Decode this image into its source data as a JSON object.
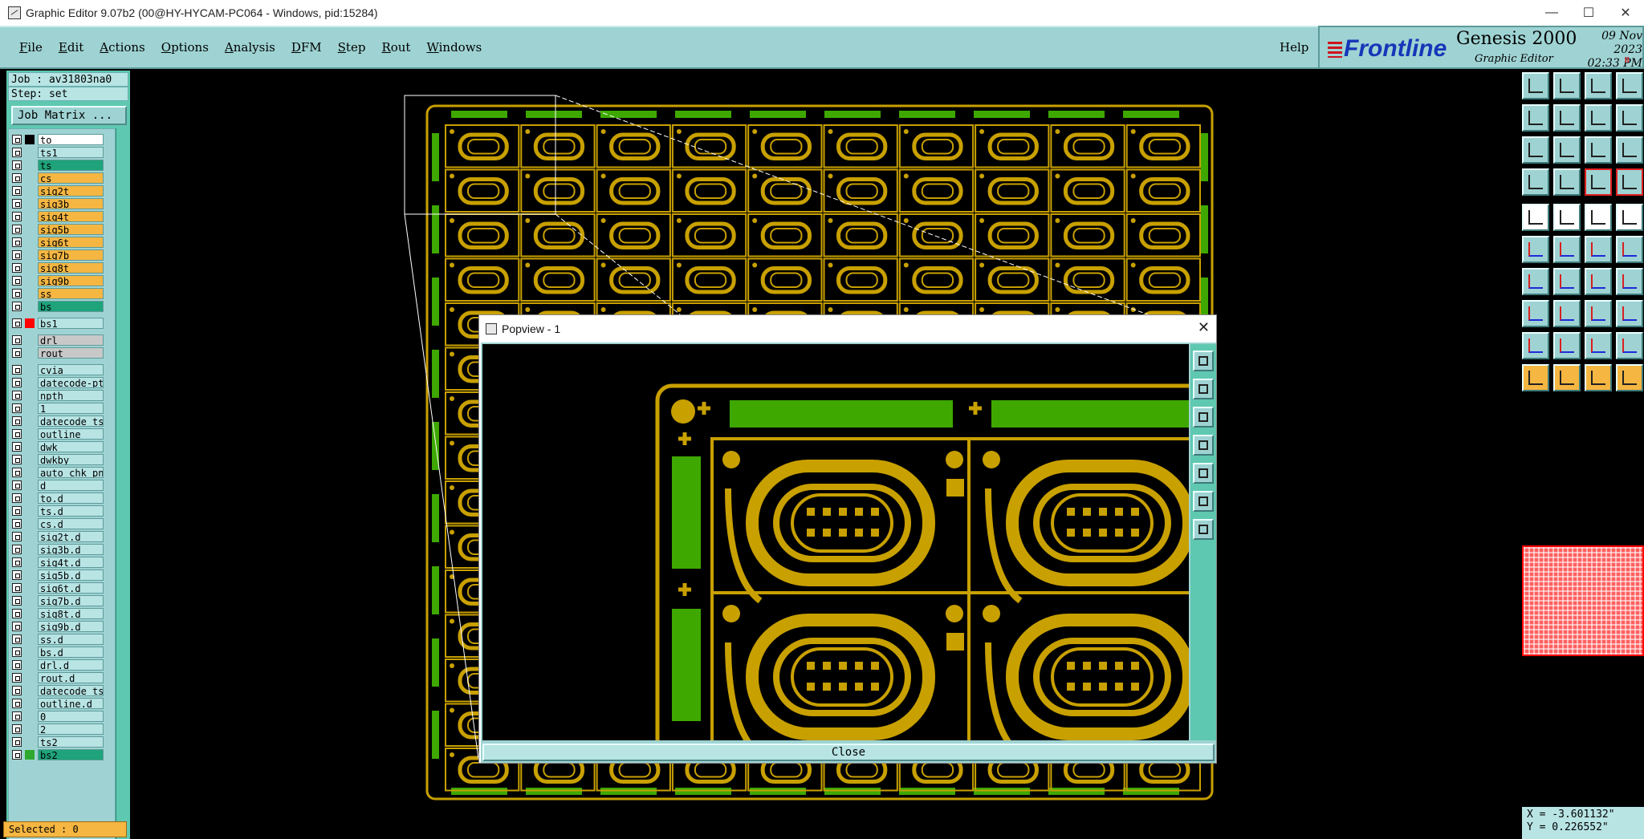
{
  "window": {
    "title": "Graphic Editor 9.07b2 (00@HY-HYCAM-PC064 - Windows, pid:15284)",
    "minimize": "—",
    "maximize": "☐",
    "close": "✕"
  },
  "menubar": {
    "items": [
      "File",
      "Edit",
      "Actions",
      "Options",
      "Analysis",
      "DFM",
      "Step",
      "Rout",
      "Windows"
    ],
    "help": "Help"
  },
  "brand": {
    "logo": "Frontline",
    "product": "Genesis 2000",
    "subtitle": "Graphic Editor",
    "date": "09 Nov 2023",
    "time": "02:33 PM",
    "pause_indicator": "II"
  },
  "job": {
    "job_label": "Job : av31803na0",
    "step_label": "Step: set",
    "matrix_button": "Job Matrix ..."
  },
  "layers": [
    {
      "name": "to",
      "color": "#000000",
      "label_bg": "#ffffff"
    },
    {
      "name": "ts1",
      "color": "#9fd3d3",
      "label_bg": "#b8e4e4"
    },
    {
      "name": "ts",
      "color": "#9fd3d3",
      "label_bg": "#1ea37a"
    },
    {
      "name": "cs",
      "color": "#9fd3d3",
      "label_bg": "#f5b642"
    },
    {
      "name": "sig2t",
      "color": "#9fd3d3",
      "label_bg": "#f5b642"
    },
    {
      "name": "sig3b",
      "color": "#9fd3d3",
      "label_bg": "#f5b642"
    },
    {
      "name": "sig4t",
      "color": "#9fd3d3",
      "label_bg": "#f5b642"
    },
    {
      "name": "sig5b",
      "color": "#9fd3d3",
      "label_bg": "#f5b642"
    },
    {
      "name": "sig6t",
      "color": "#9fd3d3",
      "label_bg": "#f5b642"
    },
    {
      "name": "sig7b",
      "color": "#9fd3d3",
      "label_bg": "#f5b642"
    },
    {
      "name": "sig8t",
      "color": "#9fd3d3",
      "label_bg": "#f5b642"
    },
    {
      "name": "sig9b",
      "color": "#9fd3d3",
      "label_bg": "#f5b642"
    },
    {
      "name": "ss",
      "color": "#9fd3d3",
      "label_bg": "#f5b642"
    },
    {
      "name": "bs",
      "color": "#9fd3d3",
      "label_bg": "#1ea37a"
    },
    {
      "name": "bs1",
      "color": "#ff0000",
      "label_bg": "#b8e4e4"
    },
    {
      "name": "drl",
      "color": "#9fd3d3",
      "label_bg": "#c8c8c8"
    },
    {
      "name": "rout",
      "color": "#9fd3d3",
      "label_bg": "#c8c8c8"
    },
    {
      "name": "cvia",
      "color": "#9fd3d3",
      "label_bg": "#b8e4e4"
    },
    {
      "name": "datecode-ptc",
      "color": "#9fd3d3",
      "label_bg": "#b8e4e4"
    },
    {
      "name": "npth",
      "color": "#9fd3d3",
      "label_bg": "#b8e4e4"
    },
    {
      "name": "1",
      "color": "#9fd3d3",
      "label_bg": "#b8e4e4"
    },
    {
      "name": "datecode_ts",
      "color": "#9fd3d3",
      "label_bg": "#b8e4e4"
    },
    {
      "name": "outline",
      "color": "#9fd3d3",
      "label_bg": "#b8e4e4"
    },
    {
      "name": "dwk",
      "color": "#9fd3d3",
      "label_bg": "#b8e4e4"
    },
    {
      "name": "dwkby",
      "color": "#9fd3d3",
      "label_bg": "#b8e4e4"
    },
    {
      "name": "auto_chk_pn_",
      "color": "#9fd3d3",
      "label_bg": "#b8e4e4"
    },
    {
      "name": "d",
      "color": "#9fd3d3",
      "label_bg": "#b8e4e4"
    },
    {
      "name": "to.d",
      "color": "#9fd3d3",
      "label_bg": "#b8e4e4"
    },
    {
      "name": "ts.d",
      "color": "#9fd3d3",
      "label_bg": "#b8e4e4"
    },
    {
      "name": "cs.d",
      "color": "#9fd3d3",
      "label_bg": "#b8e4e4"
    },
    {
      "name": "sig2t.d",
      "color": "#9fd3d3",
      "label_bg": "#b8e4e4"
    },
    {
      "name": "sig3b.d",
      "color": "#9fd3d3",
      "label_bg": "#b8e4e4"
    },
    {
      "name": "sig4t.d",
      "color": "#9fd3d3",
      "label_bg": "#b8e4e4"
    },
    {
      "name": "sig5b.d",
      "color": "#9fd3d3",
      "label_bg": "#b8e4e4"
    },
    {
      "name": "sig6t.d",
      "color": "#9fd3d3",
      "label_bg": "#b8e4e4"
    },
    {
      "name": "sig7b.d",
      "color": "#9fd3d3",
      "label_bg": "#b8e4e4"
    },
    {
      "name": "sig8t.d",
      "color": "#9fd3d3",
      "label_bg": "#b8e4e4"
    },
    {
      "name": "sig9b.d",
      "color": "#9fd3d3",
      "label_bg": "#b8e4e4"
    },
    {
      "name": "ss.d",
      "color": "#9fd3d3",
      "label_bg": "#b8e4e4"
    },
    {
      "name": "bs.d",
      "color": "#9fd3d3",
      "label_bg": "#b8e4e4"
    },
    {
      "name": "drl.d",
      "color": "#9fd3d3",
      "label_bg": "#b8e4e4"
    },
    {
      "name": "rout.d",
      "color": "#9fd3d3",
      "label_bg": "#b8e4e4"
    },
    {
      "name": "datecode_ts",
      "color": "#9fd3d3",
      "label_bg": "#b8e4e4"
    },
    {
      "name": "outline.d",
      "color": "#9fd3d3",
      "label_bg": "#b8e4e4"
    },
    {
      "name": "0",
      "color": "#9fd3d3",
      "label_bg": "#b8e4e4"
    },
    {
      "name": "2",
      "color": "#9fd3d3",
      "label_bg": "#b8e4e4"
    },
    {
      "name": "ts2",
      "color": "#9fd3d3",
      "label_bg": "#b8e4e4"
    },
    {
      "name": "bs2",
      "color": "#2ea82e",
      "label_bg": "#1ea37a"
    }
  ],
  "status": {
    "selected": "Selected : 0",
    "x_coord": "X = -3.601132\"",
    "y_coord": "Y = 0.226552\""
  },
  "popview": {
    "title": "Popview - 1",
    "close_button": "Close",
    "close_icon": "✕"
  },
  "colors": {
    "copper": "#c8a000",
    "solder_green": "#3ea800",
    "panel_teal": "#9fd3d3",
    "accent_orange": "#f5b642"
  }
}
